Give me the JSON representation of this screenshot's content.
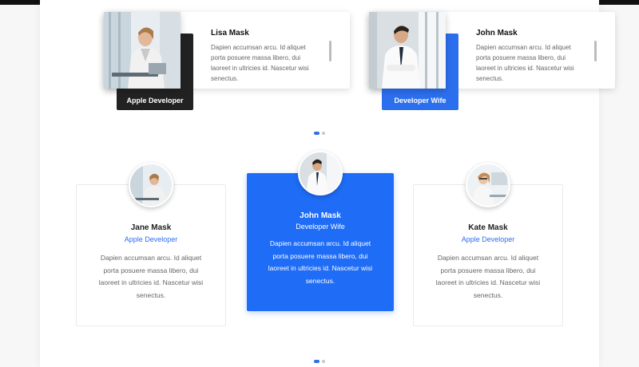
{
  "top_cards": [
    {
      "name": "Lisa Mask",
      "text": "Dapien accumsan arcu. Id aliquet porta posuere massa libero, dui laoreet in ultricies id. Nascetur wisi senectus.",
      "role": "Apple Developer"
    },
    {
      "name": "John Mask",
      "text": "Dapien accumsan arcu. Id aliquet porta posuere massa libero, dui laoreet in ultricies id. Nascetur wisi senectus.",
      "role": "Developer Wife"
    }
  ],
  "bottom_cards": [
    {
      "name": "Jane Mask",
      "role": "Apple Developer",
      "text": "Dapien accumsan arcu. Id aliquet porta posuere massa libero, dui laoreet in ultricies id. Nascetur wisi senectus."
    },
    {
      "name": "John Mask",
      "role": "Developer Wife",
      "text": "Dapien accumsan arcu. Id aliquet porta posuere massa libero, dui laoreet in ultricies id. Nascetur wisi senectus."
    },
    {
      "name": "Kate Mask",
      "role": "Apple Developer",
      "text": "Dapien accumsan arcu. Id aliquet porta posuere massa libero, dui laoreet in ultricies id. Nascetur wisi senectus."
    }
  ],
  "colors": {
    "accent": "#1f6cf6",
    "dark_tag": "#222222"
  },
  "carousels": {
    "top": {
      "active_page": 1,
      "page_count": 2
    },
    "bottom": {
      "active_page": 1,
      "page_count": 2
    }
  }
}
